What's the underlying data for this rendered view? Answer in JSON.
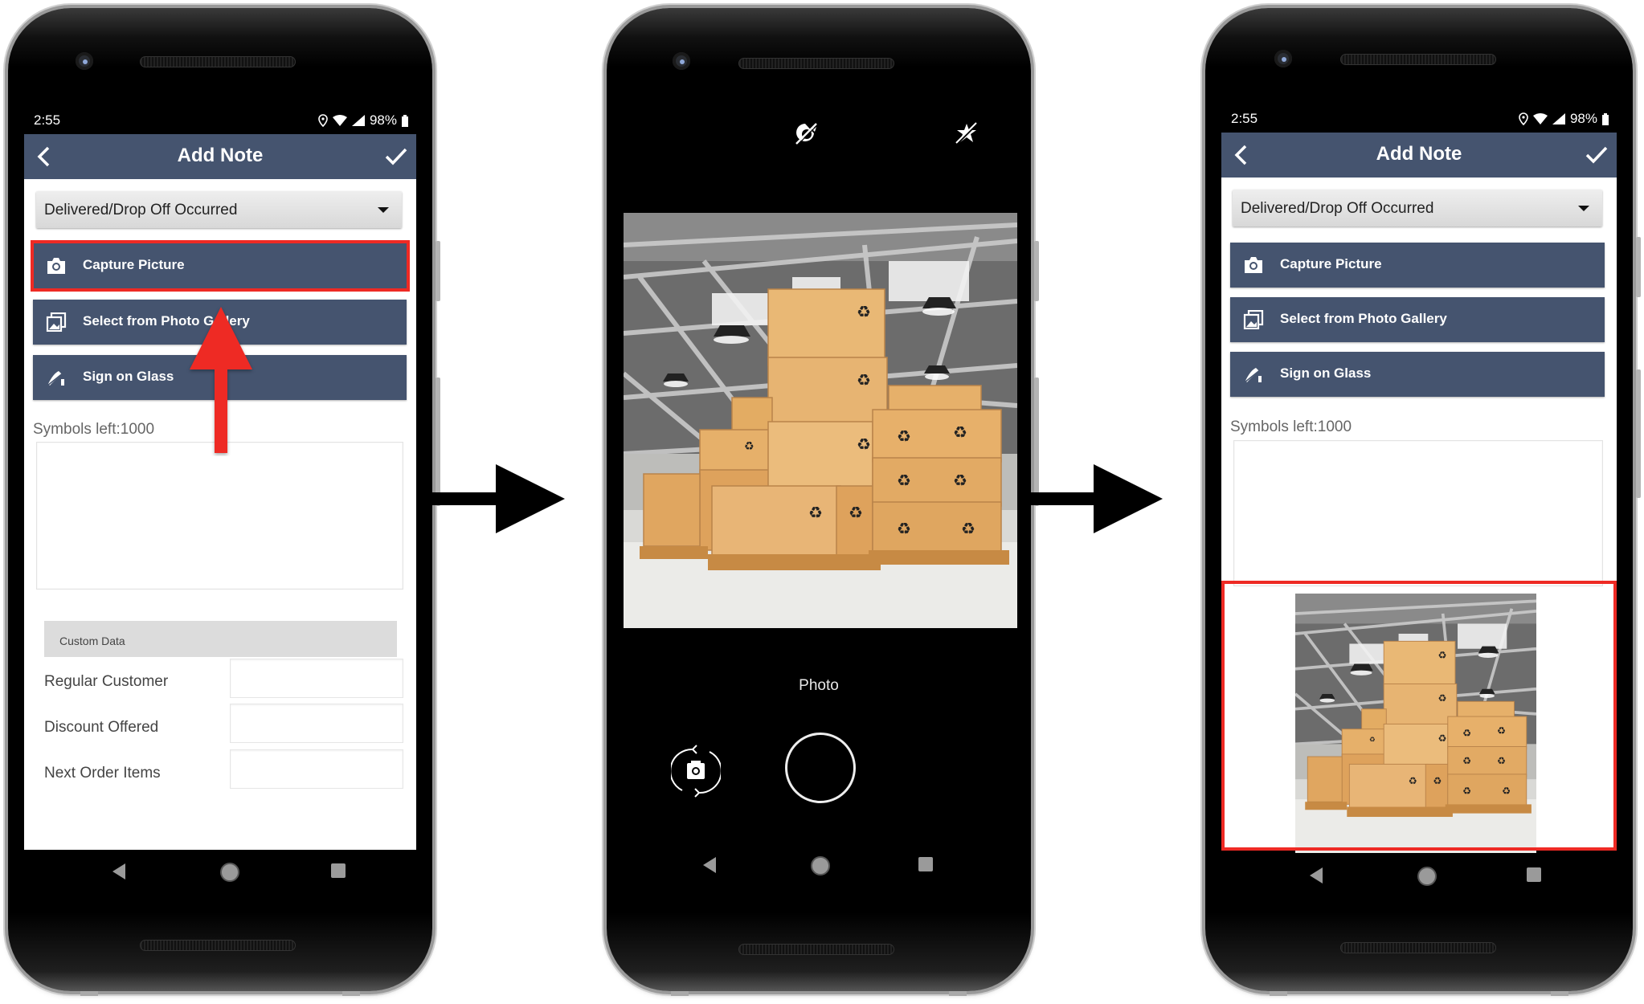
{
  "steps": [
    {
      "screen": "add_note",
      "status_bar": {
        "time": "2:55",
        "battery": "98%"
      },
      "header": {
        "title": "Add Note",
        "back_icon": "chevron-left-icon",
        "confirm_icon": "checkmark-icon"
      },
      "dropdown": {
        "selected": "Delivered/Drop Off Occurred"
      },
      "buttons": [
        {
          "label": "Capture Picture",
          "icon": "camera-icon",
          "highlighted": true
        },
        {
          "label": "Select from Photo Gallery",
          "icon": "gallery-icon"
        },
        {
          "label": "Sign on Glass",
          "icon": "signature-icon"
        }
      ],
      "symbols_left": "Symbols left:1000",
      "note_text": "",
      "custom_data": {
        "title": "Custom Data",
        "fields": [
          {
            "label": "Regular Customer",
            "value": ""
          },
          {
            "label": "Discount Offered",
            "value": ""
          },
          {
            "label": "Next Order Items",
            "value": ""
          }
        ]
      },
      "annotation": {
        "type": "up-arrow",
        "color": "#ee2a24",
        "points_to": "Capture Picture"
      }
    },
    {
      "screen": "camera",
      "top_icons": [
        "timer-off-icon",
        "flash-off-icon"
      ],
      "preview": "warehouse boxes on pallets",
      "mode_label": "Photo",
      "controls": [
        "switch-camera-icon",
        "shutter-button"
      ]
    },
    {
      "screen": "add_note_with_photo",
      "status_bar": {
        "time": "2:55",
        "battery": "98%"
      },
      "header": {
        "title": "Add Note",
        "back_icon": "chevron-left-icon",
        "confirm_icon": "checkmark-icon"
      },
      "dropdown": {
        "selected": "Delivered/Drop Off Occurred"
      },
      "buttons": [
        {
          "label": "Capture Picture",
          "icon": "camera-icon"
        },
        {
          "label": "Select from Photo Gallery",
          "icon": "gallery-icon"
        },
        {
          "label": "Sign on Glass",
          "icon": "signature-icon"
        }
      ],
      "symbols_left": "Symbols left:1000",
      "note_text": "",
      "attached_photo": {
        "description": "warehouse boxes on pallets",
        "highlighted": true
      }
    }
  ],
  "colors": {
    "app_bar": "#45546f",
    "button": "#45546f",
    "highlight": "#ee2a24",
    "flow_arrow": "#000000"
  }
}
